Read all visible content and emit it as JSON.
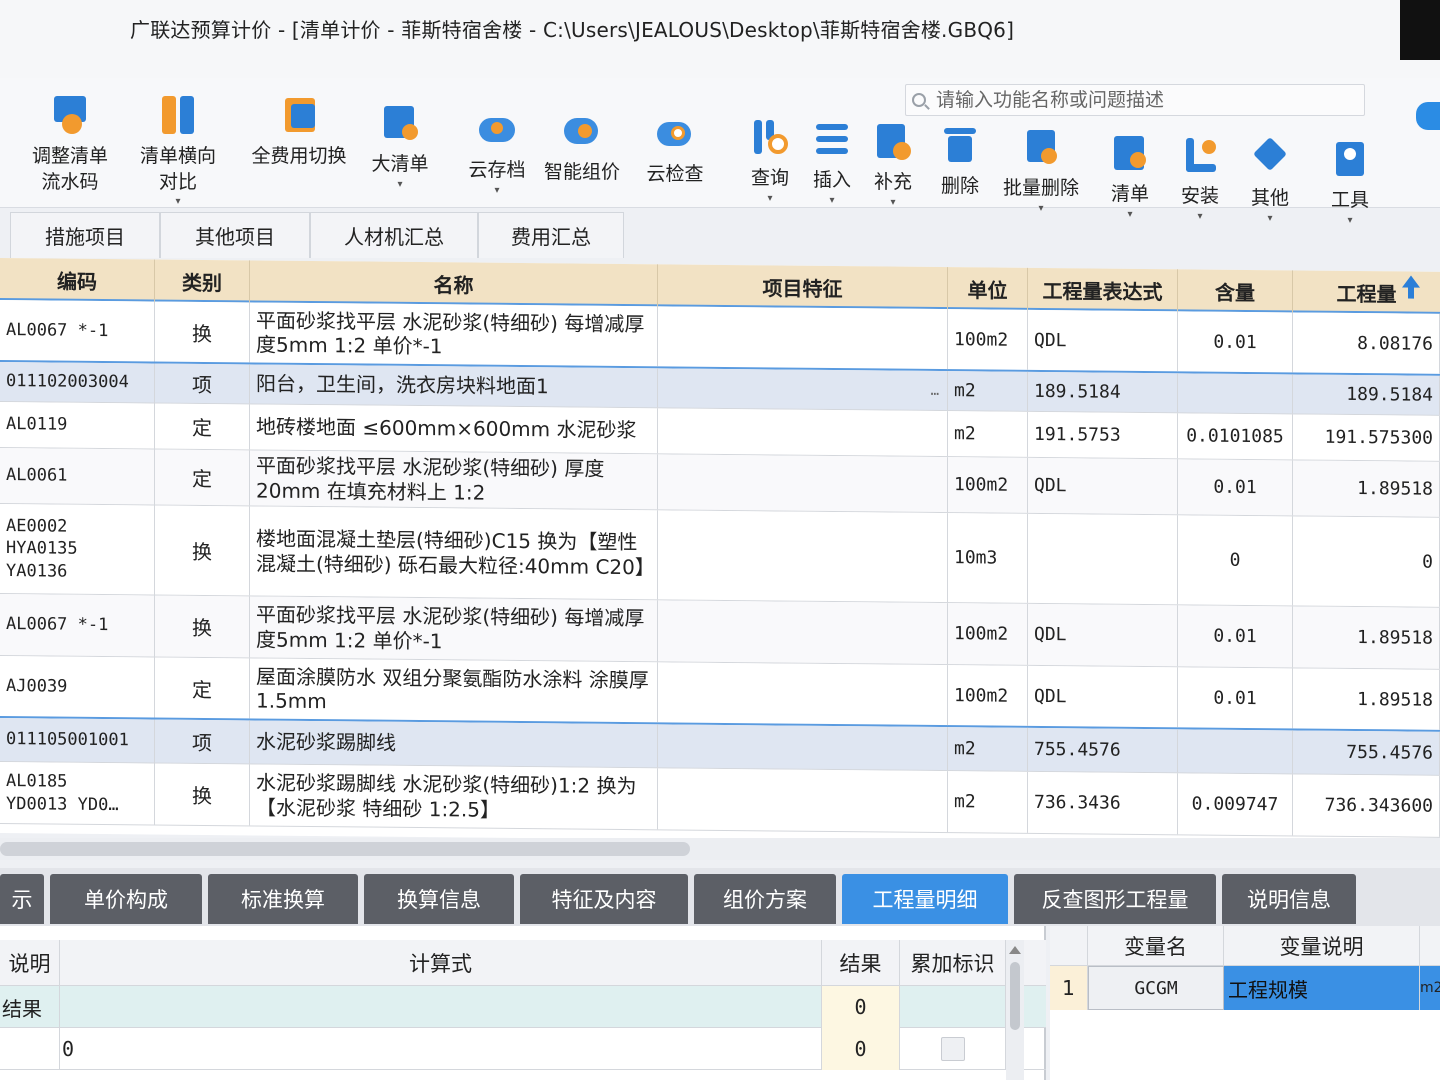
{
  "window": {
    "title": "广联达预算计价 - [清单计价 - 菲斯特宿舍楼 - C:\\Users\\JEALOUS\\Desktop\\菲斯特宿舍楼.GBQ6]"
  },
  "search": {
    "placeholder": "请输入功能名称或问题描述"
  },
  "ribbon": {
    "tools": [
      {
        "label": "调整清单\n流水码",
        "icon": "list-adjust-icon"
      },
      {
        "label": "清单横向\n对比",
        "icon": "compare-icon"
      },
      {
        "label": "全费用切换",
        "icon": "cost-switch-icon"
      },
      {
        "label": "大清单",
        "icon": "big-list-icon"
      },
      {
        "label": "云存档",
        "icon": "cloud-save-icon"
      },
      {
        "label": "智能组价",
        "icon": "smart-price-icon"
      },
      {
        "label": "云检查",
        "icon": "cloud-check-icon"
      },
      {
        "label": "查询",
        "icon": "query-icon"
      },
      {
        "label": "插入",
        "icon": "insert-icon"
      },
      {
        "label": "补充",
        "icon": "supplement-icon"
      },
      {
        "label": "删除",
        "icon": "delete-icon"
      },
      {
        "label": "批量删除",
        "icon": "batch-delete-icon"
      },
      {
        "label": "清单",
        "icon": "bill-icon"
      },
      {
        "label": "安装",
        "icon": "install-icon"
      },
      {
        "label": "其他",
        "icon": "other-icon"
      },
      {
        "label": "工具",
        "icon": "tools-icon"
      }
    ]
  },
  "sheet_tabs": [
    "措施项目",
    "其他项目",
    "人材机汇总",
    "费用汇总"
  ],
  "grid": {
    "columns": [
      "编码",
      "类别",
      "名称",
      "项目特征",
      "单位",
      "工程量表达式",
      "含量",
      "工程量"
    ],
    "rows": [
      {
        "code": "AL0067 *-1",
        "cat": "换",
        "name": "平面砂浆找平层 水泥砂浆(特细砂) 每增减厚度5mm 1:2 单价*-1",
        "feature": "",
        "unit": "100m2",
        "expr": "QDL",
        "content": "0.01",
        "qty": "8.08176"
      },
      {
        "code": "011102003004",
        "cat": "项",
        "name": "阳台，卫生间，洗衣房块料地面1",
        "feature": "…",
        "unit": "m2",
        "expr": "189.5184",
        "content": "",
        "qty": "189.5184"
      },
      {
        "code": "AL0119",
        "cat": "定",
        "name": "地砖楼地面 ≤600mm×600mm 水泥砂浆",
        "feature": "",
        "unit": "m2",
        "expr": "191.5753",
        "content": "0.0101085",
        "qty": "191.575300"
      },
      {
        "code": "AL0061",
        "cat": "定",
        "name": "平面砂浆找平层 水泥砂浆(特细砂) 厚度20mm 在填充材料上 1:2",
        "feature": "",
        "unit": "100m2",
        "expr": "QDL",
        "content": "0.01",
        "qty": "1.89518"
      },
      {
        "code": "AE0002\nHYA0135\nYA0136",
        "cat": "换",
        "name": "楼地面混凝土垫层(特细砂)C15 换为【塑性混凝土(特细砂) 砾石最大粒径:40mm C20】",
        "feature": "",
        "unit": "10m3",
        "expr": "",
        "content": "0",
        "qty": "0"
      },
      {
        "code": "AL0067 *-1",
        "cat": "换",
        "name": "平面砂浆找平层 水泥砂浆(特细砂) 每增减厚度5mm 1:2 单价*-1",
        "feature": "",
        "unit": "100m2",
        "expr": "QDL",
        "content": "0.01",
        "qty": "1.89518"
      },
      {
        "code": "AJ0039",
        "cat": "定",
        "name": "屋面涂膜防水 双组分聚氨酯防水涂料 涂膜厚1.5mm",
        "feature": "",
        "unit": "100m2",
        "expr": "QDL",
        "content": "0.01",
        "qty": "1.89518"
      },
      {
        "code": "011105001001",
        "cat": "项",
        "name": "水泥砂浆踢脚线",
        "feature": "",
        "unit": "m2",
        "expr": "755.4576",
        "content": "",
        "qty": "755.4576"
      },
      {
        "code": "AL0185\nYD0013 YD0…",
        "cat": "换",
        "name": "水泥砂浆踢脚线 水泥砂浆(特细砂)1:2 换为【水泥砂浆 特细砂 1:2.5】",
        "feature": "",
        "unit": "m2",
        "expr": "736.3436",
        "content": "0.009747",
        "qty": "736.343600"
      }
    ]
  },
  "bottom_tabs": [
    "示",
    "单价构成",
    "标准换算",
    "换算信息",
    "特征及内容",
    "组价方案",
    "工程量明细",
    "反查图形工程量",
    "说明信息"
  ],
  "bottom_active_tab": "工程量明细",
  "detail": {
    "columns": [
      "说明",
      "计算式",
      "结果",
      "累加标识"
    ],
    "rows": [
      {
        "desc": "结果",
        "formula": "",
        "result": "0"
      },
      {
        "desc": "",
        "formula": "0",
        "result": "0"
      }
    ]
  },
  "variables": {
    "columns": [
      "变量名",
      "变量说明"
    ],
    "rows": [
      {
        "index": "1",
        "name": "GCGM",
        "desc": "工程规模",
        "extra": "m2"
      }
    ]
  },
  "colors": {
    "accent": "#3a90e4",
    "header": "#f2e2c4",
    "section_row": "#dfe6f2"
  }
}
